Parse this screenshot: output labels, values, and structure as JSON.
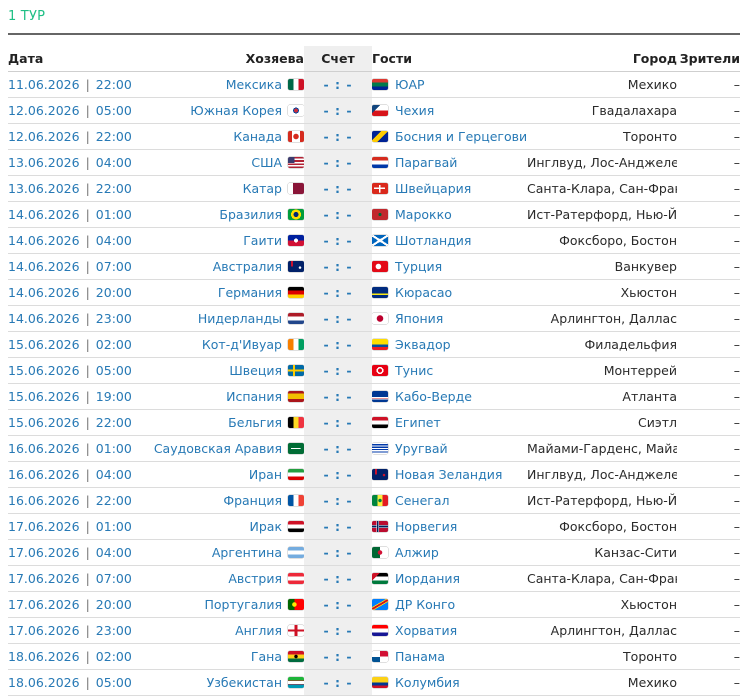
{
  "round_title": "1 ТУР",
  "headers": {
    "date": "Дата",
    "home": "Хозяева",
    "score": "Счет",
    "guests": "Гости",
    "city": "Город",
    "spectators": "Зрители"
  },
  "date_separator": "|",
  "matches": [
    {
      "date": "11.06.2026",
      "time": "22:00",
      "home": "Мексика",
      "home_flag": "flag-mexico-icon",
      "score": "- : -",
      "guest": "ЮАР",
      "guest_flag": "flag-south-africa-icon",
      "city": "Мехико",
      "spectators": "–"
    },
    {
      "date": "12.06.2026",
      "time": "05:00",
      "home": "Южная Корея",
      "home_flag": "flag-south-korea-icon",
      "score": "- : -",
      "guest": "Чехия",
      "guest_flag": "flag-czechia-icon",
      "city": "Гвадалахара",
      "spectators": "–"
    },
    {
      "date": "12.06.2026",
      "time": "22:00",
      "home": "Канада",
      "home_flag": "flag-canada-icon",
      "score": "- : -",
      "guest": "Босния и Герцеговина",
      "guest_flag": "flag-bosnia-icon",
      "city": "Торонто",
      "spectators": "–"
    },
    {
      "date": "13.06.2026",
      "time": "04:00",
      "home": "США",
      "home_flag": "flag-usa-icon",
      "score": "- : -",
      "guest": "Парагвай",
      "guest_flag": "flag-paraguay-icon",
      "city": "Инглвуд, Лос-Анджелес",
      "spectators": "–"
    },
    {
      "date": "13.06.2026",
      "time": "22:00",
      "home": "Катар",
      "home_flag": "flag-qatar-icon",
      "score": "- : -",
      "guest": "Швейцария",
      "guest_flag": "flag-switzerland-icon",
      "city": "Санта-Клара, Сан-Франциско",
      "spectators": "–"
    },
    {
      "date": "14.06.2026",
      "time": "01:00",
      "home": "Бразилия",
      "home_flag": "flag-brazil-icon",
      "score": "- : -",
      "guest": "Марокко",
      "guest_flag": "flag-morocco-icon",
      "city": "Ист-Ратерфорд, Нью-Йорк",
      "spectators": "–"
    },
    {
      "date": "14.06.2026",
      "time": "04:00",
      "home": "Гаити",
      "home_flag": "flag-haiti-icon",
      "score": "- : -",
      "guest": "Шотландия",
      "guest_flag": "flag-scotland-icon",
      "city": "Фоксборо, Бостон",
      "spectators": "–"
    },
    {
      "date": "14.06.2026",
      "time": "07:00",
      "home": "Австралия",
      "home_flag": "flag-australia-icon",
      "score": "- : -",
      "guest": "Турция",
      "guest_flag": "flag-turkey-icon",
      "city": "Ванкувер",
      "spectators": "–"
    },
    {
      "date": "14.06.2026",
      "time": "20:00",
      "home": "Германия",
      "home_flag": "flag-germany-icon",
      "score": "- : -",
      "guest": "Кюрасао",
      "guest_flag": "flag-curacao-icon",
      "city": "Хьюстон",
      "spectators": "–"
    },
    {
      "date": "14.06.2026",
      "time": "23:00",
      "home": "Нидерланды",
      "home_flag": "flag-netherlands-icon",
      "score": "- : -",
      "guest": "Япония",
      "guest_flag": "flag-japan-icon",
      "city": "Арлингтон, Даллас",
      "spectators": "–"
    },
    {
      "date": "15.06.2026",
      "time": "02:00",
      "home": "Кот-д'Ивуар",
      "home_flag": "flag-ivory-coast-icon",
      "score": "- : -",
      "guest": "Эквадор",
      "guest_flag": "flag-ecuador-icon",
      "city": "Филадельфия",
      "spectators": "–"
    },
    {
      "date": "15.06.2026",
      "time": "05:00",
      "home": "Швеция",
      "home_flag": "flag-sweden-icon",
      "score": "- : -",
      "guest": "Тунис",
      "guest_flag": "flag-tunisia-icon",
      "city": "Монтеррей",
      "spectators": "–"
    },
    {
      "date": "15.06.2026",
      "time": "19:00",
      "home": "Испания",
      "home_flag": "flag-spain-icon",
      "score": "- : -",
      "guest": "Кабо-Верде",
      "guest_flag": "flag-cape-verde-icon",
      "city": "Атланта",
      "spectators": "–"
    },
    {
      "date": "15.06.2026",
      "time": "22:00",
      "home": "Бельгия",
      "home_flag": "flag-belgium-icon",
      "score": "- : -",
      "guest": "Египет",
      "guest_flag": "flag-egypt-icon",
      "city": "Сиэтл",
      "spectators": "–"
    },
    {
      "date": "16.06.2026",
      "time": "01:00",
      "home": "Саудовская Аравия",
      "home_flag": "flag-saudi-arabia-icon",
      "score": "- : -",
      "guest": "Уругвай",
      "guest_flag": "flag-uruguay-icon",
      "city": "Майами-Гарденс, Майами",
      "spectators": "–"
    },
    {
      "date": "16.06.2026",
      "time": "04:00",
      "home": "Иран",
      "home_flag": "flag-iran-icon",
      "score": "- : -",
      "guest": "Новая Зеландия",
      "guest_flag": "flag-new-zealand-icon",
      "city": "Инглвуд, Лос-Анджелес",
      "spectators": "–"
    },
    {
      "date": "16.06.2026",
      "time": "22:00",
      "home": "Франция",
      "home_flag": "flag-france-icon",
      "score": "- : -",
      "guest": "Сенегал",
      "guest_flag": "flag-senegal-icon",
      "city": "Ист-Ратерфорд, Нью-Йорк",
      "spectators": "–"
    },
    {
      "date": "17.06.2026",
      "time": "01:00",
      "home": "Ирак",
      "home_flag": "flag-iraq-icon",
      "score": "- : -",
      "guest": "Норвегия",
      "guest_flag": "flag-norway-icon",
      "city": "Фоксборо, Бостон",
      "spectators": "–"
    },
    {
      "date": "17.06.2026",
      "time": "04:00",
      "home": "Аргентина",
      "home_flag": "flag-argentina-icon",
      "score": "- : -",
      "guest": "Алжир",
      "guest_flag": "flag-algeria-icon",
      "city": "Канзас-Сити",
      "spectators": "–"
    },
    {
      "date": "17.06.2026",
      "time": "07:00",
      "home": "Австрия",
      "home_flag": "flag-austria-icon",
      "score": "- : -",
      "guest": "Иордания",
      "guest_flag": "flag-jordan-icon",
      "city": "Санта-Клара, Сан-Франциско",
      "spectators": "–"
    },
    {
      "date": "17.06.2026",
      "time": "20:00",
      "home": "Португалия",
      "home_flag": "flag-portugal-icon",
      "score": "- : -",
      "guest": "ДР Конго",
      "guest_flag": "flag-dr-congo-icon",
      "city": "Хьюстон",
      "spectators": "–"
    },
    {
      "date": "17.06.2026",
      "time": "23:00",
      "home": "Англия",
      "home_flag": "flag-england-icon",
      "score": "- : -",
      "guest": "Хорватия",
      "guest_flag": "flag-croatia-icon",
      "city": "Арлингтон, Даллас",
      "spectators": "–"
    },
    {
      "date": "18.06.2026",
      "time": "02:00",
      "home": "Гана",
      "home_flag": "flag-ghana-icon",
      "score": "- : -",
      "guest": "Панама",
      "guest_flag": "flag-panama-icon",
      "city": "Торонто",
      "spectators": "–"
    },
    {
      "date": "18.06.2026",
      "time": "05:00",
      "home": "Узбекистан",
      "home_flag": "flag-uzbekistan-icon",
      "score": "- : -",
      "guest": "Колумбия",
      "guest_flag": "flag-colombia-icon",
      "city": "Мехико",
      "spectators": "–"
    }
  ],
  "colors": {
    "accent_green": "#1fbf85",
    "link_blue": "#2779b5",
    "score_column_bg": "#efefef"
  }
}
